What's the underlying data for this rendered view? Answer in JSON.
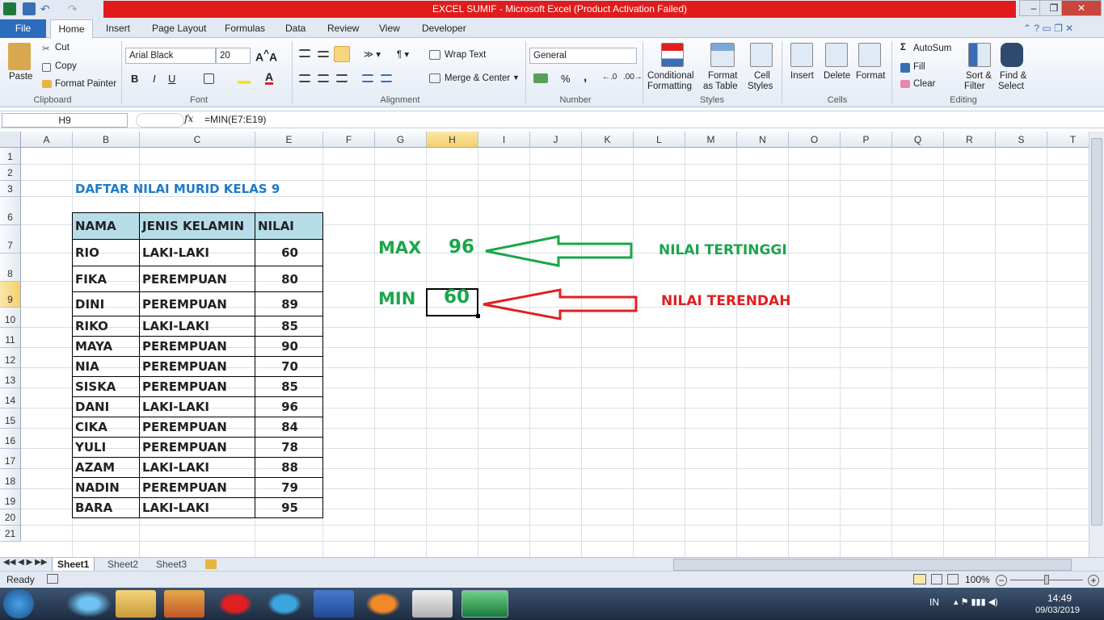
{
  "window": {
    "title": "EXCEL SUMIF -  Microsoft Excel (Product Activation Failed)",
    "minimize": "–",
    "restore": "❐",
    "close": "✕"
  },
  "tabs": [
    "File",
    "Home",
    "Insert",
    "Page Layout",
    "Formulas",
    "Data",
    "Review",
    "View",
    "Developer"
  ],
  "ribbon": {
    "clipboard": {
      "paste": "Paste",
      "cut": "Cut",
      "copy": "Copy",
      "format_painter": "Format Painter",
      "label": "Clipboard"
    },
    "font": {
      "name": "Arial Black",
      "size": "20",
      "bold": "B",
      "italic": "I",
      "underline": "U",
      "label": "Font"
    },
    "alignment": {
      "wrap": "Wrap Text",
      "merge": "Merge & Center",
      "label": "Alignment"
    },
    "number": {
      "format": "General",
      "percent": "%",
      "comma": ",",
      "label": "Number"
    },
    "styles": {
      "conditional": "Conditional",
      "conditional2": "Formatting",
      "format_table": "Format",
      "format_table2": "as Table",
      "cell_styles": "Cell",
      "cell_styles2": "Styles",
      "label": "Styles"
    },
    "cells": {
      "insert": "Insert",
      "delete": "Delete",
      "format": "Format",
      "label": "Cells"
    },
    "editing": {
      "autosum": "AutoSum",
      "fill": "Fill",
      "clear": "Clear",
      "sort": "Sort &",
      "sort2": "Filter",
      "find": "Find &",
      "find2": "Select",
      "label": "Editing"
    }
  },
  "formula_bar": {
    "cell_ref": "H9",
    "fx": "fx",
    "formula": "=MIN(E7:E19)"
  },
  "columns": [
    "A",
    "B",
    "C",
    "E",
    "F",
    "G",
    "H",
    "I",
    "J",
    "K",
    "L",
    "M",
    "N",
    "O",
    "P",
    "Q",
    "R",
    "S",
    "T"
  ],
  "rows": [
    "1",
    "2",
    "3",
    "6",
    "7",
    "8",
    "9",
    "10",
    "11",
    "12",
    "13",
    "14",
    "15",
    "16",
    "17",
    "18",
    "19",
    "20",
    "21"
  ],
  "sheet": {
    "title": "DAFTAR NILAI MURID KELAS 9",
    "headers": [
      "NAMA",
      "JENIS KELAMIN",
      "NILAI"
    ],
    "records": [
      [
        "RIO",
        "LAKI-LAKI",
        "60"
      ],
      [
        "FIKA",
        "PEREMPUAN",
        "80"
      ],
      [
        "DINI",
        "PEREMPUAN",
        "89"
      ],
      [
        "RIKO",
        "LAKI-LAKI",
        "85"
      ],
      [
        "MAYA",
        "PEREMPUAN",
        "90"
      ],
      [
        "NIA",
        "PEREMPUAN",
        "70"
      ],
      [
        "SISKA",
        "PEREMPUAN",
        "85"
      ],
      [
        "DANI",
        "LAKI-LAKI",
        "96"
      ],
      [
        "CIKA",
        "PEREMPUAN",
        "84"
      ],
      [
        "YULI",
        "PEREMPUAN",
        "78"
      ],
      [
        "AZAM",
        "LAKI-LAKI",
        "88"
      ],
      [
        "NADIN",
        "PEREMPUAN",
        "79"
      ],
      [
        "BARA",
        "LAKI-LAKI",
        "95"
      ]
    ],
    "max_label": "MAX",
    "max_value": "96",
    "min_label": "MIN",
    "min_value": "60",
    "max_note": "NILAI TERTINGGI",
    "min_note": "NILAI TERENDAH"
  },
  "sheet_tabs": [
    "Sheet1",
    "Sheet2",
    "Sheet3"
  ],
  "status": {
    "ready": "Ready",
    "zoom": "100%"
  },
  "taskbar": {
    "lang": "IN",
    "time": "14:49",
    "date": "09/03/2019"
  },
  "colors": {
    "green": "#1aa64a",
    "red": "#e02020",
    "blue": "#1f7ac8",
    "table_header": "#b7dde8"
  }
}
